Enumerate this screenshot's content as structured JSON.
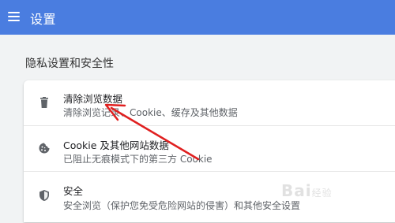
{
  "header": {
    "title": "设置",
    "menu_icon": "hamburger-menu-icon",
    "bg_color": "#4a7de0"
  },
  "section": {
    "title": "隐私设置和安全性"
  },
  "items": [
    {
      "title": "清除浏览数据",
      "subtitle": "清除浏览记录、Cookie、缓存及其他数据",
      "icon": "trash-icon"
    },
    {
      "title": "Cookie 及其他网站数据",
      "subtitle": "已阻止无痕模式下的第三方 Cookie",
      "icon": "cookie-icon"
    },
    {
      "title": "安全",
      "subtitle": "安全浏览（保护您免受危险网站的侵害）和其他安全设置",
      "icon": "shield-icon"
    }
  ],
  "annotation": {
    "arrow_color": "#e02020"
  },
  "watermark": {
    "text": "Bai",
    "suffix": "经验"
  }
}
